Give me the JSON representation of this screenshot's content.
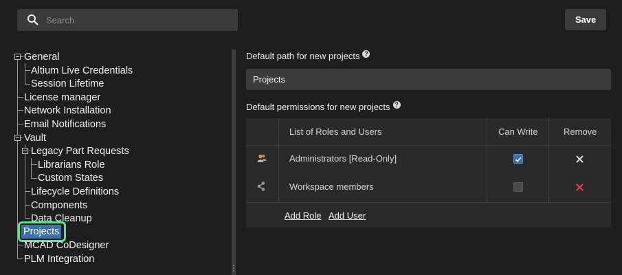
{
  "search": {
    "placeholder": "Search"
  },
  "toolbar": {
    "save_label": "Save"
  },
  "tree": {
    "items": [
      {
        "label": "General"
      },
      {
        "label": "Altium Live Credentials"
      },
      {
        "label": "Session Lifetime"
      },
      {
        "label": "License manager"
      },
      {
        "label": "Network Installation"
      },
      {
        "label": "Email Notifications"
      },
      {
        "label": "Vault"
      },
      {
        "label": "Legacy Part Requests"
      },
      {
        "label": "Librarians Role"
      },
      {
        "label": "Custom States"
      },
      {
        "label": "Lifecycle Definitions"
      },
      {
        "label": "Components"
      },
      {
        "label": "Data Cleanup"
      },
      {
        "label": "Projects",
        "selected": true
      },
      {
        "label": "MCAD CoDesigner"
      },
      {
        "label": "PLM Integration"
      }
    ]
  },
  "main": {
    "default_path_label": "Default path for new projects",
    "default_path_value": "Projects",
    "permissions_label": "Default permissions for new projects",
    "table": {
      "headers": [
        "List of Roles and Users",
        "Can Write",
        "Remove"
      ],
      "rows": [
        {
          "icon": "user-group-icon",
          "name": "Administrators [Read-Only]",
          "can_write": true,
          "remove_color": "#d9d9d9"
        },
        {
          "icon": "share-icon",
          "name": "Workspace members",
          "can_write": false,
          "remove_color": "#e0484c"
        }
      ],
      "add_role": "Add Role",
      "add_user": "Add User"
    }
  },
  "colors": {
    "accent": "#3d6fa8",
    "highlight": "#5fe08a",
    "danger": "#e0484c"
  }
}
